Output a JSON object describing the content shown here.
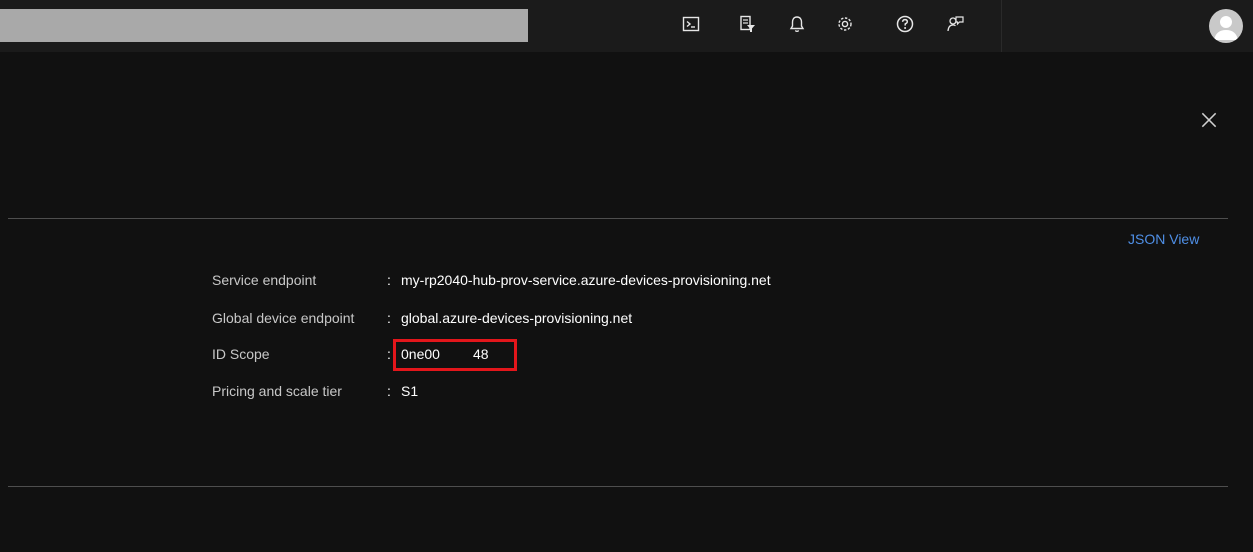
{
  "topbar": {
    "icons": [
      "cloud-shell-icon",
      "directory-filter-icon",
      "notifications-bell-icon",
      "settings-gear-icon",
      "help-question-icon",
      "feedback-icon"
    ],
    "avatar_icon": "user-avatar-icon"
  },
  "panel": {
    "close_icon": "close-x-icon",
    "json_view_label": "JSON View",
    "properties": [
      {
        "label": "Service endpoint",
        "colon": ":",
        "value": "my-rp2040-hub-prov-service.azure-devices-provisioning.net"
      },
      {
        "label": "Global device endpoint",
        "colon": ":",
        "value": "global.azure-devices-provisioning.net"
      },
      {
        "label": "ID Scope",
        "colon": ":",
        "value_part1": "0ne00",
        "value_part2": "48"
      },
      {
        "label": "Pricing and scale tier",
        "colon": ":",
        "value": "S1"
      }
    ],
    "highlight_color": "#e3161b"
  },
  "colors": {
    "background": "#111111",
    "topbar": "#1b1b1b",
    "search_box": "#a9a9a9",
    "link": "#4f8fe6",
    "label": "#c8c8c8",
    "value": "#ffffff"
  }
}
